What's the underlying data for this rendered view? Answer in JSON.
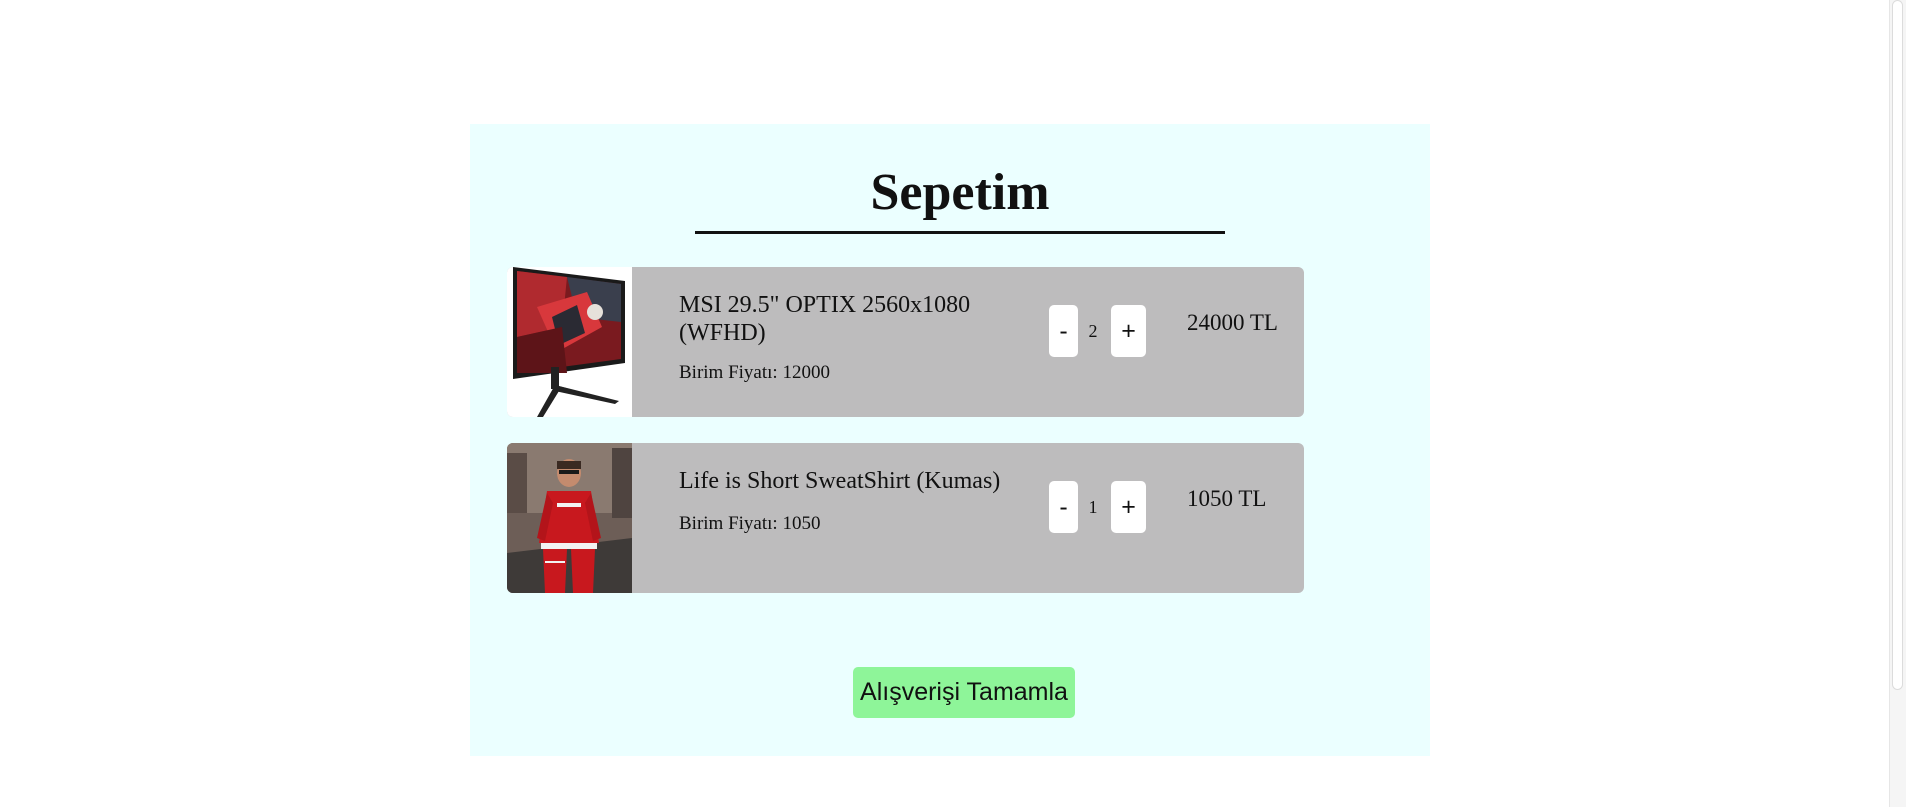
{
  "cart": {
    "title": "Sepetim",
    "items": [
      {
        "name": "MSI 29.5\" OPTIX 2560x1080 (WFHD)",
        "unit_price_label": "Birim Fiyatı: 12000",
        "quantity": "2",
        "minus_label": "-",
        "plus_label": "+",
        "total": "24000 TL",
        "image_icon": "monitor-product-image"
      },
      {
        "name": "Life is Short SweatShirt (Kumas)",
        "unit_price_label": "Birim Fiyatı: 1050",
        "quantity": "1",
        "minus_label": "-",
        "plus_label": "+",
        "total": "1050 TL",
        "image_icon": "sweatshirt-product-image"
      }
    ],
    "checkout_label": "Alışverişi Tamamla"
  },
  "colors": {
    "panel_background": "#ebffff",
    "item_background": "#bdbcbd",
    "checkout_button": "#8ef599"
  }
}
